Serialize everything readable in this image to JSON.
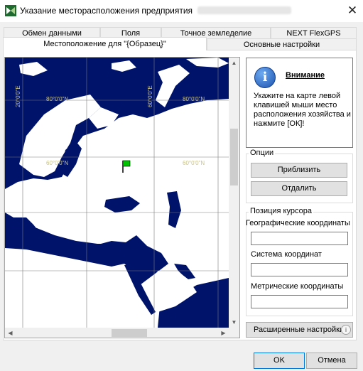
{
  "window": {
    "title": "Указание месторасположения предприятия",
    "close_glyph": "✕",
    "icon": "app-logo-icon"
  },
  "tabs_row1": [
    "Обмен данными",
    "Поля",
    "Точное земледелие",
    "NEXT FlexGPS"
  ],
  "tabs_row2": [
    "Местоположение для \"{Образец}\"",
    "Основные настройки"
  ],
  "active_tab": "Местоположение для \"{Образец}\"",
  "map": {
    "lat_labels": [
      "80°0'0\"N",
      "80°0'0\"N",
      "60°0'0\"N",
      "60°0'0\"N"
    ],
    "lon_labels": [
      "20°0'0\"E",
      "60°0'0\"E"
    ],
    "colors": {
      "sea": "#00136b",
      "grid": "#7a7a7a",
      "marker": "#00c400",
      "label": "#c9c38a"
    },
    "scroll_arrows": {
      "up": "▲",
      "down": "▼",
      "left": "◀",
      "right": "▶"
    }
  },
  "warning": {
    "title": "Внимание",
    "icon_glyph": "i",
    "text": "Укажите на карте левой клавишей мыши место расположения хозяйства и нажмите [ОК]!"
  },
  "options": {
    "label": "Опции",
    "zoom_in": "Приблизить",
    "zoom_out": "Отдалить"
  },
  "cursor": {
    "label": "Позиция курсора",
    "geo_label": "Географические координаты",
    "geo_value": "",
    "system_label": "Система координат",
    "system_value": "",
    "metric_label": "Метрические координаты",
    "metric_value": ""
  },
  "advanced": {
    "label": "Расширенные настройки",
    "icon_glyph": "i"
  },
  "footer": {
    "ok": "OK",
    "cancel": "Отмена"
  }
}
